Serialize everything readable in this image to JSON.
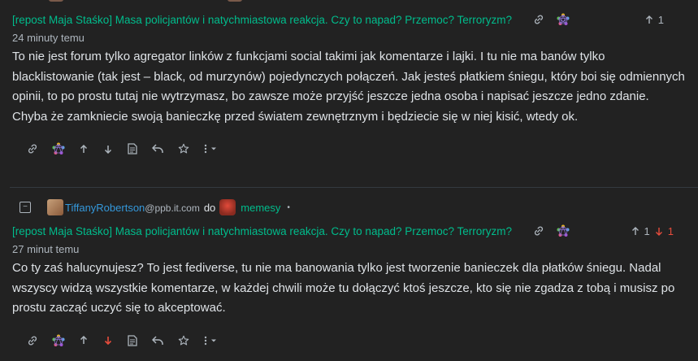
{
  "comments": [
    {
      "post_title": "[repost Maja Staśko] Masa policjantów i natychmiastowa reakcja. Czy to napad? Przemoc? Terroryzm?",
      "time": "24 minuty temu",
      "body": "To nie jest forum tylko agregator linków z funkcjami social takimi jak komentarze i lajki. I tu nie ma banów tylko blacklistowanie (tak jest – black, od murzynów) pojedynczych połączeń. Jak jesteś płatkiem śniegu, który boi się odmiennych opinii, to po prostu tutaj nie wytrzymasz, bo zawsze może przyjść jeszcze jedna osoba i napisać jeszcze jedno zdanie. Chyba że zamkniecie swoją banieczkę przed światem zewnętrznym i będziecie się w niej kisić, wtedy ok.",
      "upvotes": "1",
      "downvotes": ""
    },
    {
      "author": "TiffanyRobertson",
      "author_instance": "@ppb.it.com",
      "to_word": "do",
      "community": "memesy",
      "separator": "•",
      "collapse": "−",
      "post_title": "[repost Maja Staśko] Masa policjantów i natychmiastowa reakcja. Czy to napad? Przemoc? Terroryzm?",
      "time": "27 minut temu",
      "body": "Co ty zaś halucynujesz? To jest fediverse, tu nie ma banowania tylko jest tworzenie banieczek dla płatków śniegu. Nadal wszyscy widzą wszystkie komentarze, w każdej chwili może tu dołączyć ktoś jeszcze, kto się nie zgadza z tobą i musisz po prostu zacząć uczyć się to akceptować.",
      "upvotes": "1",
      "downvotes": "1"
    }
  ],
  "icons": {
    "link": "link-icon",
    "fediverse": "fediverse-icon",
    "upvote": "arrow-up-icon",
    "downvote": "arrow-down-icon",
    "source": "file-text-icon",
    "reply": "reply-icon",
    "save": "star-icon",
    "more": "more-dots-icon"
  },
  "colors": {
    "background": "#222222",
    "link_green": "#00bc8c",
    "username_blue": "#3498db",
    "downvote_red": "#e74c3c",
    "muted": "#adb5bd"
  }
}
